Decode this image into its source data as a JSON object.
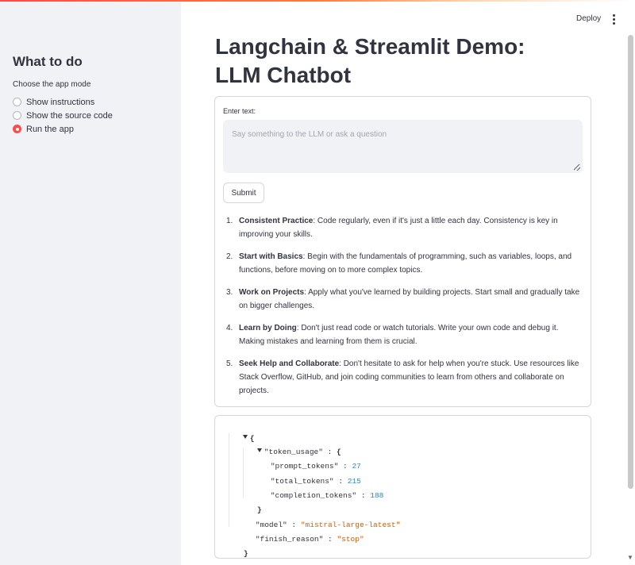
{
  "header": {
    "deploy_label": "Deploy"
  },
  "sidebar": {
    "title": "What to do",
    "mode_label": "Choose the app mode",
    "options": [
      {
        "label": "Show instructions",
        "selected": false
      },
      {
        "label": "Show the source code",
        "selected": false
      },
      {
        "label": "Run the app",
        "selected": true
      }
    ]
  },
  "main": {
    "title_line1": "Langchain & Streamlit Demo:",
    "title_line2": "LLM Chatbot",
    "input_label": "Enter text:",
    "input_placeholder": "Say something to the LLM or ask a question",
    "input_value": "",
    "submit_label": "Submit",
    "tips": [
      {
        "num": "1.",
        "title": "Consistent Practice",
        "text": ": Code regularly, even if it's just a little each day. Consistency is key in improving your skills."
      },
      {
        "num": "2.",
        "title": "Start with Basics",
        "text": ": Begin with the fundamentals of programming, such as variables, loops, and functions, before moving on to more complex topics."
      },
      {
        "num": "3.",
        "title": "Work on Projects",
        "text": ": Apply what you've learned by building projects. Start small and gradually take on bigger challenges."
      },
      {
        "num": "4.",
        "title": "Learn by Doing",
        "text": ": Don't just read code or watch tutorials. Write your own code and debug it. Making mistakes and learning from them is crucial."
      },
      {
        "num": "5.",
        "title": "Seek Help and Collaborate",
        "text": ": Don't hesitate to ask for help when you're stuck. Use resources like Stack Overflow, GitHub, and join coding communities to learn from others and collaborate on projects."
      }
    ]
  },
  "json_view": {
    "open_brace": "{",
    "close_brace": "}",
    "token_usage_key": "\"token_usage\"",
    "prompt_tokens_key": "\"prompt_tokens\"",
    "prompt_tokens": "27",
    "total_tokens_key": "\"total_tokens\"",
    "total_tokens": "215",
    "completion_tokens_key": "\"completion_tokens\"",
    "completion_tokens": "188",
    "model_key": "\"model\"",
    "model": "\"mistral-large-latest\"",
    "finish_reason_key": "\"finish_reason\"",
    "finish_reason": "\"stop\"",
    "colon": " : ",
    "colors": {
      "number": "#2b86c6",
      "string": "#e05a00"
    }
  },
  "theme": {
    "accent": "#ff4b4b",
    "sidebar_bg": "#f0f2f6"
  }
}
